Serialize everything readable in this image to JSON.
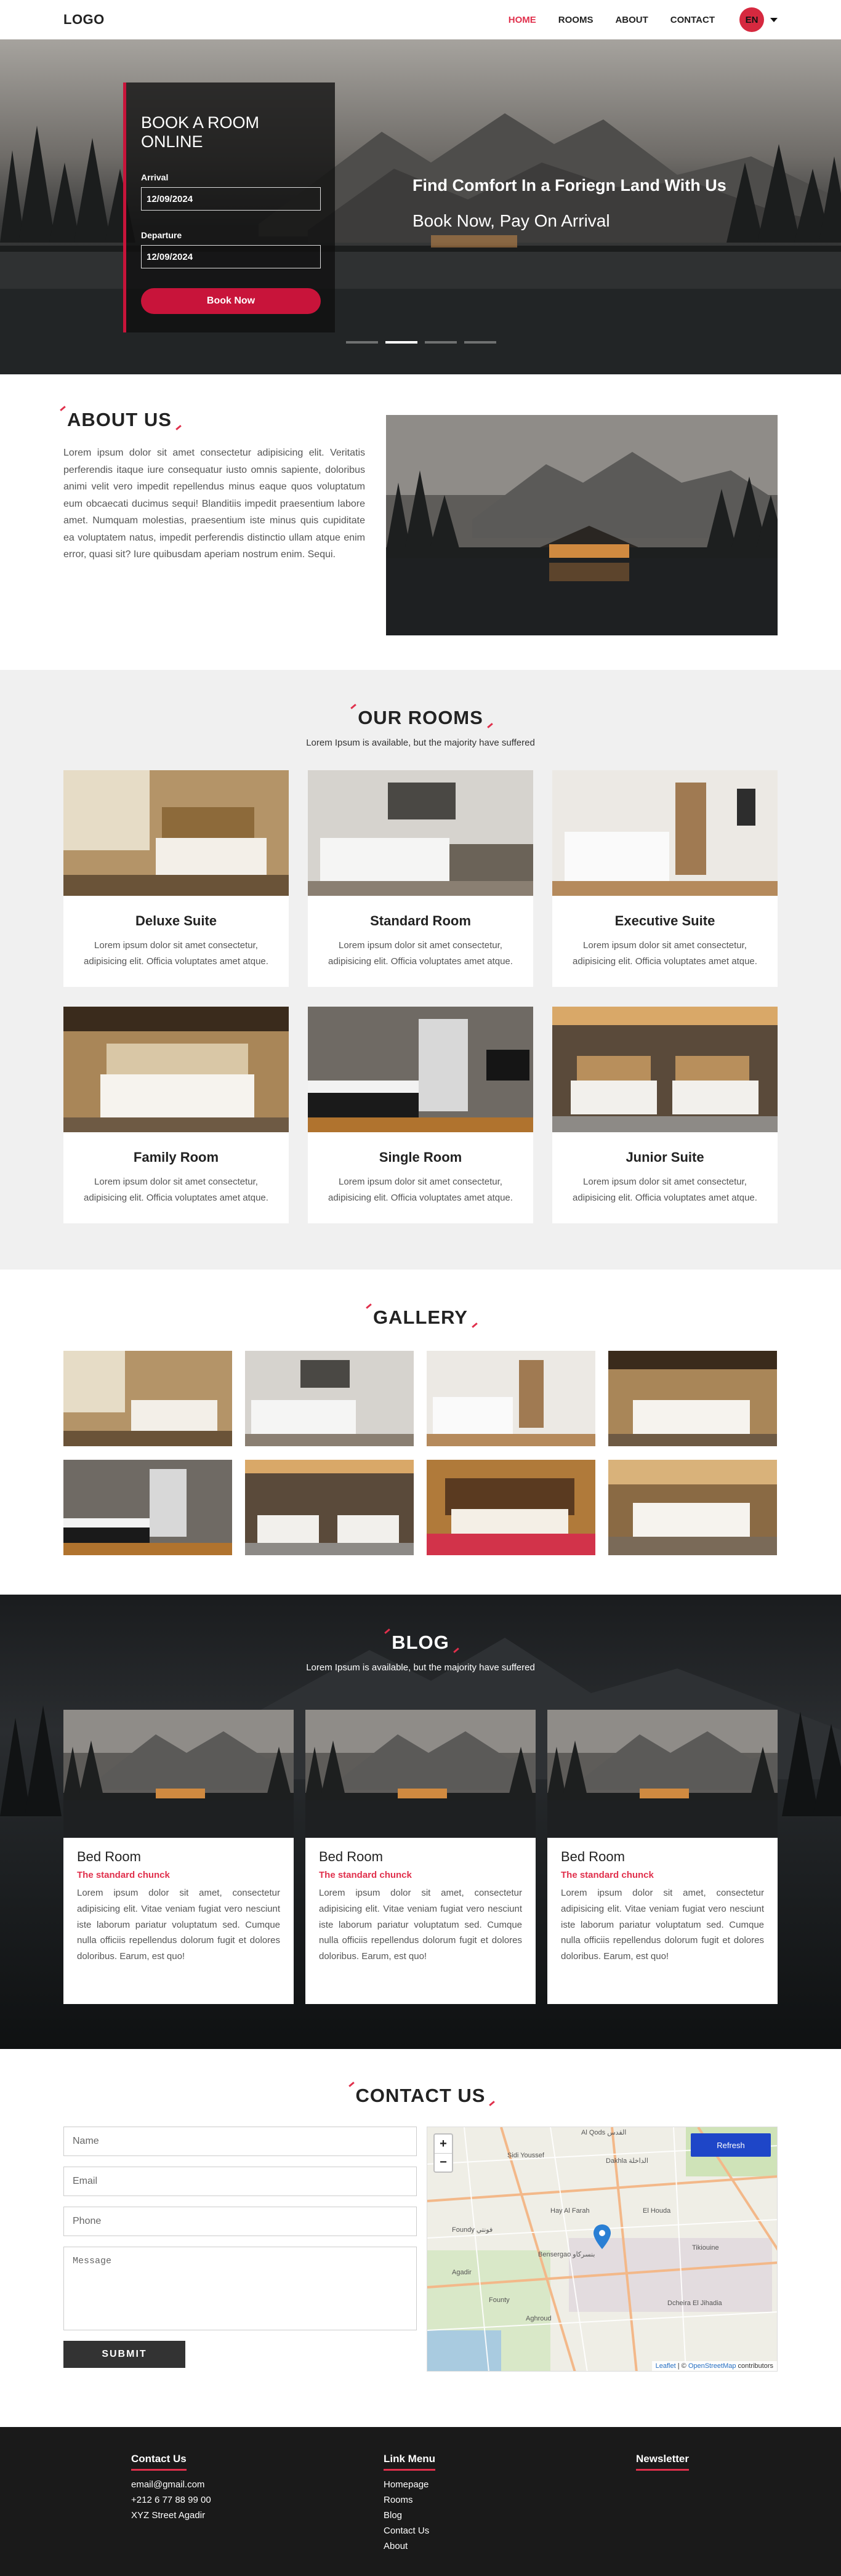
{
  "header": {
    "logo": "LOGO",
    "nav": [
      "HOME",
      "ROOMS",
      "ABOUT",
      "CONTACT"
    ],
    "lang": "EN"
  },
  "hero": {
    "booking_title": "BOOK A ROOM ONLINE",
    "arrival_label": "Arrival",
    "arrival_value": "12/09/2024",
    "departure_label": "Departure",
    "departure_value": "12/09/2024",
    "button": "Book Now",
    "headline": "Find Comfort In a Foriegn Land With Us",
    "tagline": "Book Now, Pay On Arrival",
    "slides": 4,
    "active_slide": 2
  },
  "about": {
    "title": "ABOUT US",
    "text": "Lorem ipsum dolor sit amet consectetur adipisicing elit. Veritatis perferendis itaque iure consequatur iusto omnis sapiente, doloribus animi velit vero impedit repellendus minus eaque quos voluptatum eum obcaecati ducimus sequi! Blanditiis impedit praesentium labore amet. Numquam molestias, praesentium iste minus quis cupiditate ea voluptatem natus, impedit perferendis distinctio ullam atque enim error, quasi sit? Iure quibusdam aperiam nostrum enim. Sequi."
  },
  "rooms": {
    "title": "OUR ROOMS",
    "subtitle": "Lorem Ipsum is available, but the majority have suffered",
    "items": [
      {
        "name": "Deluxe Suite",
        "desc": "Lorem ipsum dolor sit amet consectetur, adipisicing elit. Officia voluptates amet atque."
      },
      {
        "name": "Standard Room",
        "desc": "Lorem ipsum dolor sit amet consectetur, adipisicing elit. Officia voluptates amet atque."
      },
      {
        "name": "Executive Suite",
        "desc": "Lorem ipsum dolor sit amet consectetur, adipisicing elit. Officia voluptates amet atque."
      },
      {
        "name": "Family Room",
        "desc": "Lorem ipsum dolor sit amet consectetur, adipisicing elit. Officia voluptates amet atque."
      },
      {
        "name": "Single Room",
        "desc": "Lorem ipsum dolor sit amet consectetur, adipisicing elit. Officia voluptates amet atque."
      },
      {
        "name": "Junior Suite",
        "desc": "Lorem ipsum dolor sit amet consectetur, adipisicing elit. Officia voluptates amet atque."
      }
    ]
  },
  "gallery": {
    "title": "GALLERY"
  },
  "blog": {
    "title": "BLOG",
    "subtitle": "Lorem Ipsum is available, but the majority have suffered",
    "posts": [
      {
        "title": "Bed Room",
        "subtitle": "The standard chunck",
        "text": "Lorem ipsum dolor sit amet, consectetur adipisicing elit. Vitae veniam fugiat vero nesciunt iste laborum pariatur voluptatum sed. Cumque nulla officiis repellendus dolorum fugit et dolores doloribus. Earum, est quo!"
      },
      {
        "title": "Bed Room",
        "subtitle": "The standard chunck",
        "text": "Lorem ipsum dolor sit amet, consectetur adipisicing elit. Vitae veniam fugiat vero nesciunt iste laborum pariatur voluptatum sed. Cumque nulla officiis repellendus dolorum fugit et dolores doloribus. Earum, est quo!"
      },
      {
        "title": "Bed Room",
        "subtitle": "The standard chunck",
        "text": "Lorem ipsum dolor sit amet, consectetur adipisicing elit. Vitae veniam fugiat vero nesciunt iste laborum pariatur voluptatum sed. Cumque nulla officiis repellendus dolorum fugit et dolores doloribus. Earum, est quo!"
      }
    ]
  },
  "contact": {
    "title": "CONTACT US",
    "name_placeholder": "Name",
    "email_placeholder": "Email",
    "phone_placeholder": "Phone",
    "message_placeholder": "Message",
    "submit": "SUBMIT",
    "map": {
      "zoom_in": "+",
      "zoom_out": "−",
      "refresh": "Refresh",
      "attribution_leaflet": "Leaflet",
      "attribution_sep": " | © ",
      "attribution_osm": "OpenStreetMap",
      "attribution_tail": " contributors",
      "labels": [
        "Al Qods ‎القدس",
        "Sidi Youssef",
        "Dakhla ‎الداخلة",
        "Hay Al Farah",
        "El Houda",
        "Foundy ‎فونتي",
        "Bensergao ‎بنسركاو",
        "Agadir",
        "Tikiouine",
        "Dcheira El Jihadia",
        "Aghroud",
        "Founty"
      ]
    }
  },
  "footer": {
    "contact_title": "Contact Us",
    "contact_items": [
      "email@gmail.com",
      "+212 6 77 88 99 00",
      "XYZ Street Agadir"
    ],
    "links_title": "Link Menu",
    "links": [
      "Homepage",
      "Rooms",
      "Blog",
      "Contact Us",
      "About"
    ],
    "newsletter_title": "Newsletter"
  },
  "colors": {
    "accent": "#e0304c",
    "button": "#c8143a",
    "footer_bg": "#1a1a1a",
    "rooms_bg": "#f0f0f0"
  }
}
